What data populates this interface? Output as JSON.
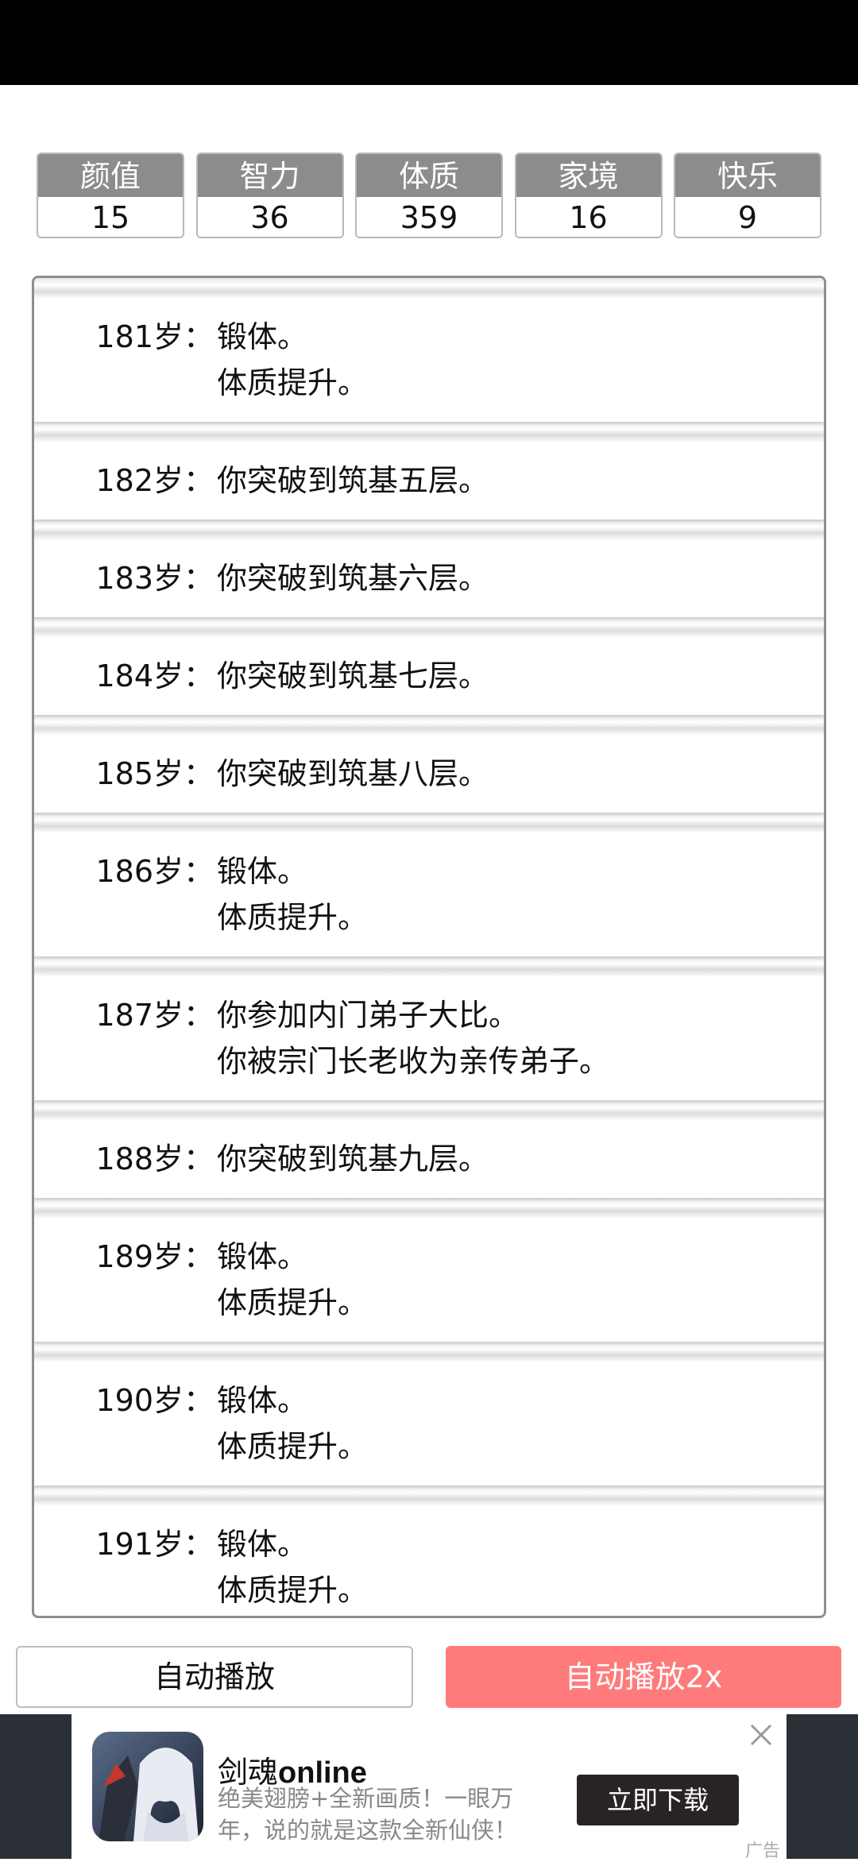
{
  "stats": [
    {
      "label": "颜值",
      "value": "15"
    },
    {
      "label": "智力",
      "value": "36"
    },
    {
      "label": "体质",
      "value": "359"
    },
    {
      "label": "家境",
      "value": "16"
    },
    {
      "label": "快乐",
      "value": "9"
    }
  ],
  "log": [
    {
      "age": "181岁：",
      "lines": [
        "锻体。",
        "体质提升。"
      ]
    },
    {
      "age": "182岁：",
      "lines": [
        "你突破到筑基五层。"
      ]
    },
    {
      "age": "183岁：",
      "lines": [
        "你突破到筑基六层。"
      ]
    },
    {
      "age": "184岁：",
      "lines": [
        "你突破到筑基七层。"
      ]
    },
    {
      "age": "185岁：",
      "lines": [
        "你突破到筑基八层。"
      ]
    },
    {
      "age": "186岁：",
      "lines": [
        "锻体。",
        "体质提升。"
      ]
    },
    {
      "age": "187岁：",
      "lines": [
        "你参加内门弟子大比。",
        "你被宗门长老收为亲传弟子。"
      ]
    },
    {
      "age": "188岁：",
      "lines": [
        "你突破到筑基九层。"
      ]
    },
    {
      "age": "189岁：",
      "lines": [
        "锻体。",
        "体质提升。"
      ]
    },
    {
      "age": "190岁：",
      "lines": [
        "锻体。",
        "体质提升。"
      ]
    },
    {
      "age": "191岁：",
      "lines": [
        "锻体。",
        "体质提升。"
      ]
    }
  ],
  "buttons": {
    "auto": "自动播放",
    "auto2x": "自动播放2x"
  },
  "ad": {
    "title_cn": "剑魂",
    "title_en": "online",
    "desc": "绝美翅膀+全新画质！一眼万年，说的就是这款全新仙侠！",
    "cta": "立即下载",
    "tag": "广告",
    "icon": "close-icon"
  }
}
